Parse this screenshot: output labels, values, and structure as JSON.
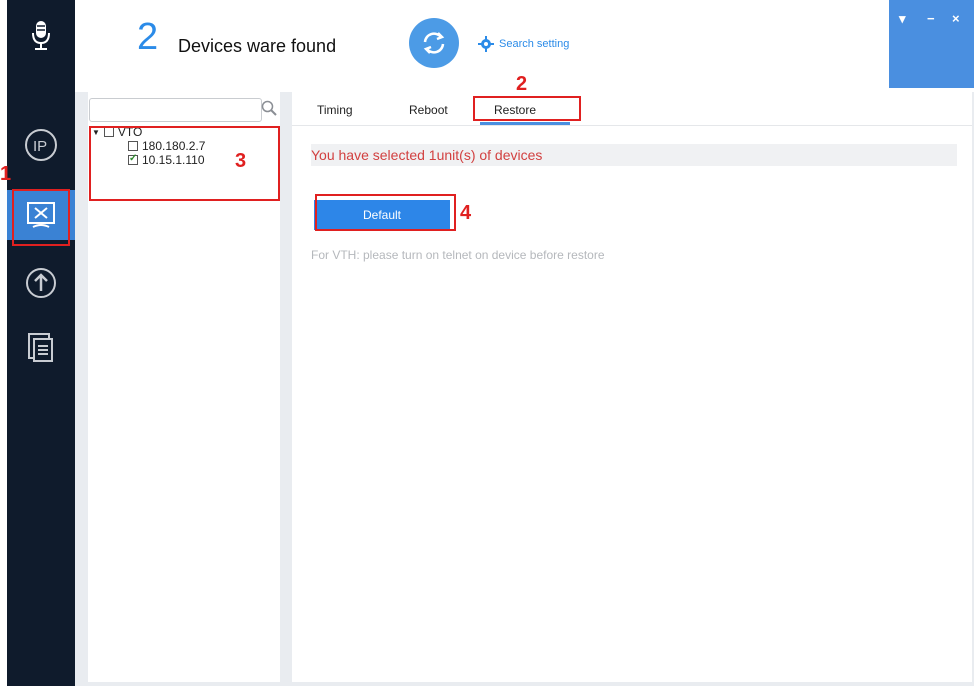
{
  "header": {
    "device_count": "2",
    "found_label": "Devices ware found",
    "search_setting_label": "Search setting",
    "window_controls": [
      "▾",
      "−",
      "×"
    ]
  },
  "sidebar": {
    "items": [
      {
        "icon": "microphone-icon"
      },
      {
        "icon": "ip-icon"
      },
      {
        "icon": "tools-icon",
        "active": true
      },
      {
        "icon": "upgrade-icon"
      },
      {
        "icon": "document-icon"
      }
    ]
  },
  "search": {
    "placeholder": ""
  },
  "tree": {
    "root_label": "VTO",
    "children": [
      {
        "label": "180.180.2.7",
        "checked": false
      },
      {
        "label": "10.15.1.110",
        "checked": true
      }
    ]
  },
  "tabs": [
    "Timing",
    "Reboot",
    "Restore"
  ],
  "active_tab": "Restore",
  "main": {
    "selected_message": "You have selected 1unit(s) of devices",
    "default_button": "Default",
    "note": "For VTH: please turn on telnet on device before restore"
  },
  "annotations": [
    "1",
    "2",
    "3",
    "4"
  ],
  "colors": {
    "sidebar": "#0f1b2c",
    "accent": "#2d86e8",
    "annotation": "#e02020",
    "warning_text": "#d24040"
  }
}
